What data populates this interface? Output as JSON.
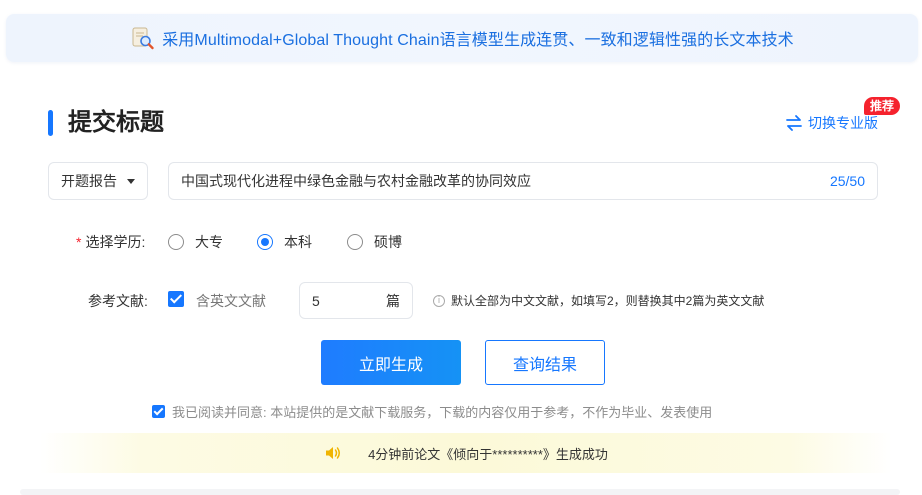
{
  "banner": {
    "text": "采用Multimodal+Global Thought Chain语言模型生成连贯、一致和逻辑性强的长文本技术",
    "icon": "document-search-icon"
  },
  "header": {
    "title": "提交标题",
    "switch_label": "切换专业版",
    "badge": "推荐"
  },
  "form": {
    "type_select": "开题报告",
    "title_value": "中国式现代化进程中绿色金融与农村金融改革的协同效应",
    "title_count": "25/50",
    "education": {
      "required_mark": "*",
      "label": "选择学历:",
      "options": [
        {
          "label": "大专",
          "selected": false
        },
        {
          "label": "本科",
          "selected": true
        },
        {
          "label": "硕博",
          "selected": false
        }
      ]
    },
    "references": {
      "label": "参考文献:",
      "include_english_label": "含英文文献",
      "include_english_checked": true,
      "count_value": "5",
      "count_unit": "篇",
      "hint": "默认全部为中文文献，如填写2，则替换其中2篇为英文文献"
    }
  },
  "actions": {
    "generate_label": "立即生成",
    "query_label": "查询结果"
  },
  "agreement": {
    "checked": true,
    "text": "我已阅读并同意: 本站提供的是文献下载服务，下载的内容仅用于参考，不作为毕业、发表使用"
  },
  "notice": {
    "text": "4分钟前论文《倾向于**********》生成成功"
  },
  "colors": {
    "accent": "#1677ff",
    "badge": "#f5222d",
    "notice_bg": "#fcf9d8"
  }
}
